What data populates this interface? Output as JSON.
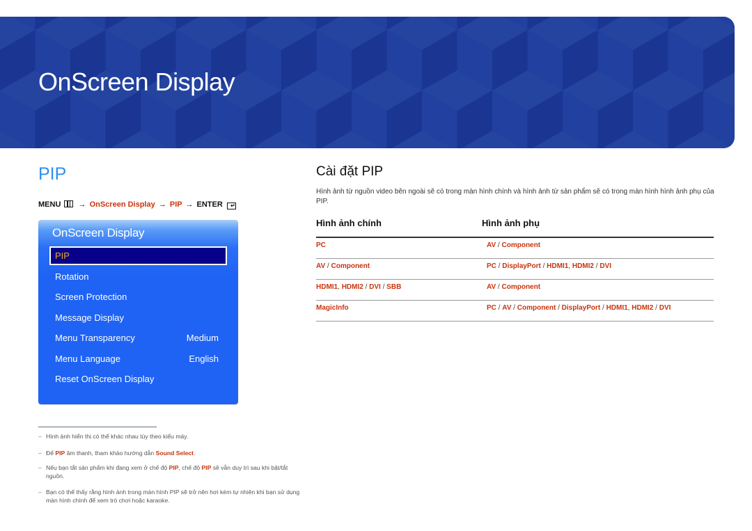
{
  "banner": {
    "title": "OnScreen Display"
  },
  "left": {
    "section_title": "PIP",
    "menu_path": {
      "menu": "MENU",
      "menu_icon": "menu-grid-icon",
      "arrow": "→",
      "step1": "OnScreen Display",
      "step2": "PIP",
      "enter": "ENTER",
      "enter_icon": "enter-icon"
    },
    "osd": {
      "title": "OnScreen Display",
      "items": [
        {
          "label": "PIP",
          "value": "",
          "selected": true
        },
        {
          "label": "Rotation",
          "value": ""
        },
        {
          "label": "Screen Protection",
          "value": ""
        },
        {
          "label": "Message Display",
          "value": ""
        },
        {
          "label": "Menu Transparency",
          "value": "Medium"
        },
        {
          "label": "Menu Language",
          "value": "English"
        },
        {
          "label": "Reset OnScreen Display",
          "value": ""
        }
      ]
    },
    "footnotes": [
      {
        "parts": [
          {
            "t": "Hình ảnh hiển thị có thể khác nhau tùy theo kiểu máy."
          }
        ]
      },
      {
        "parts": [
          {
            "t": "Để "
          },
          {
            "t": "PIP",
            "hl": true
          },
          {
            "t": " âm thanh, tham khảo hướng dẫn "
          },
          {
            "t": "Sound Select",
            "hl": true
          },
          {
            "t": "."
          }
        ]
      },
      {
        "parts": [
          {
            "t": "Nếu bạn tắt sản phẩm khi đang xem ở chế độ "
          },
          {
            "t": "PIP",
            "hl": true
          },
          {
            "t": ", chế độ "
          },
          {
            "t": "PIP",
            "hl": true
          },
          {
            "t": " sẽ vẫn duy trì sau khi bật/tắt nguồn."
          }
        ]
      },
      {
        "parts": [
          {
            "t": "Bạn có thể thấy rằng hình ảnh trong màn hình PIP sẽ trở nên hơi kém tự nhiên khi bạn sử dụng màn hình chính để xem trò chơi hoặc karaoke."
          }
        ]
      }
    ],
    "dash": "–"
  },
  "right": {
    "title": "Cài đặt PIP",
    "description": "Hình ảnh từ nguồn video bên ngoài sẽ có trong màn hình chính và hình ảnh từ sản phẩm sẽ có trong màn hình hình ảnh phụ của PIP.",
    "table": {
      "headers": [
        "Hình ảnh chính",
        "Hình ảnh phụ"
      ],
      "rows": [
        {
          "main": [
            {
              "t": "PC"
            }
          ],
          "sub": [
            {
              "t": "AV"
            },
            {
              "s": " / "
            },
            {
              "t": "Component"
            }
          ]
        },
        {
          "main": [
            {
              "t": "AV"
            },
            {
              "s": " / "
            },
            {
              "t": "Component"
            }
          ],
          "sub": [
            {
              "t": "PC"
            },
            {
              "s": " / "
            },
            {
              "t": "DisplayPort"
            },
            {
              "s": " / "
            },
            {
              "t": "HDMI1"
            },
            {
              "s": ", "
            },
            {
              "t": "HDMI2"
            },
            {
              "s": " / "
            },
            {
              "t": "DVI"
            }
          ]
        },
        {
          "main": [
            {
              "t": "HDMI1"
            },
            {
              "s": ", "
            },
            {
              "t": "HDMI2"
            },
            {
              "s": " / "
            },
            {
              "t": "DVI"
            },
            {
              "s": " / "
            },
            {
              "t": "SBB"
            }
          ],
          "sub": [
            {
              "t": "AV"
            },
            {
              "s": " / "
            },
            {
              "t": "Component"
            }
          ]
        },
        {
          "main": [
            {
              "t": "MagicInfo"
            }
          ],
          "sub": [
            {
              "t": "PC"
            },
            {
              "s": " / "
            },
            {
              "t": "AV"
            },
            {
              "s": " / "
            },
            {
              "t": "Component"
            },
            {
              "s": " / "
            },
            {
              "t": "DisplayPort"
            },
            {
              "s": " / "
            },
            {
              "t": "HDMI1"
            },
            {
              "s": ", "
            },
            {
              "t": "HDMI2"
            },
            {
              "s": " / "
            },
            {
              "t": "DVI"
            }
          ]
        }
      ]
    }
  },
  "colors": {
    "banner": "#1d3a9a",
    "accent_blue": "#2f8ff0",
    "highlight_red": "#c8340c",
    "osd_panel": "#1f63f5",
    "osd_selected_bg": "#06008a",
    "osd_selected_text": "#f2a91a"
  }
}
